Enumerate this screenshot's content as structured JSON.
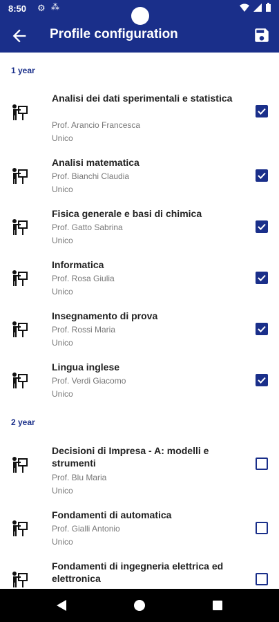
{
  "status": {
    "time": "8:50"
  },
  "app_bar": {
    "title": "Profile configuration"
  },
  "sections": [
    {
      "header": "1 year",
      "courses": [
        {
          "title": "Analisi dei dati sperimentali e statistica",
          "prof": "Prof. Arancio Francesca",
          "unit": "Unico",
          "checked": true
        },
        {
          "title": "Analisi matematica",
          "prof": "Prof. Bianchi Claudia",
          "unit": "Unico",
          "checked": true
        },
        {
          "title": "Fisica generale e basi di chimica",
          "prof": "Prof. Gatto Sabrina",
          "unit": "Unico",
          "checked": true
        },
        {
          "title": "Informatica",
          "prof": "Prof. Rosa Giulia",
          "unit": "Unico",
          "checked": true
        },
        {
          "title": "Insegnamento di prova",
          "prof": "Prof. Rossi Maria",
          "unit": "Unico",
          "checked": true
        },
        {
          "title": "Lingua inglese",
          "prof": "Prof. Verdi Giacomo",
          "unit": "Unico",
          "checked": true
        }
      ]
    },
    {
      "header": "2 year",
      "courses": [
        {
          "title": "Decisioni di Impresa - A: modelli e strumenti",
          "prof": "Prof. Blu Maria",
          "unit": "Unico",
          "checked": false
        },
        {
          "title": "Fondamenti di automatica",
          "prof": "Prof. Gialli Antonio",
          "unit": "Unico",
          "checked": false
        },
        {
          "title": "Fondamenti di ingegneria elettrica ed elettronica",
          "prof": "",
          "unit": "",
          "checked": false
        }
      ]
    }
  ],
  "colors": {
    "primary": "#1a2f8a",
    "text": "#222222",
    "secondary_text": "#777777"
  },
  "icons": {
    "back": "arrow-back-icon",
    "save": "floppy-disk-icon",
    "course": "teacher-at-board-icon"
  }
}
